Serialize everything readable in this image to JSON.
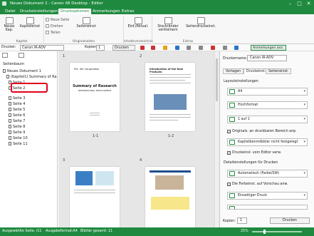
{
  "window": {
    "title": "Neues Dokument 1 - Canon iW Desktop - Editor",
    "minimize": "–",
    "maximize": "□",
    "close": "✕"
  },
  "menu": [
    "Datei",
    "Druckeinstellungen",
    "Druckoptionen",
    "Anmerkungen",
    "Extras"
  ],
  "ribbon": {
    "neues_kapitel": "Neues Kap.",
    "kapiteleinst": "Kapiteleinst",
    "neue_seite": "Neue Seite",
    "drehen": "Drehen",
    "teilen": "Teilen",
    "seiteneinst": "Seiteneinst",
    "einf_aktual": "Einf./Aktual.",
    "stockraender": "Stockränder verkleinern",
    "seitendruck": "Seitendruckeinst.",
    "groups": [
      "Kapitel",
      "Originalseiten",
      "Inhaltsverzeichnis",
      "Extras"
    ]
  },
  "toolbar": {
    "drucker_label": "Drucker:",
    "printer": "Canon iR-ADV",
    "kopien_label": "Kopien:",
    "copies": "1",
    "drucken": "Drucken",
    "anmerkungen": "Anmerkungen anz."
  },
  "tree": {
    "header": "Seitenbaum",
    "doc": "Neues Dokument 1",
    "chapter": "(Kapitel1) Summary of Ra",
    "pages": [
      "Seite 1",
      "Seite 2",
      "Seite 3",
      "Seite 4",
      "Seite 5",
      "Seite 6",
      "Seite 7",
      "Seite 8",
      "Seite 9",
      "Seite 10",
      "Seite 11"
    ]
  },
  "preview": {
    "groups": [
      "1",
      "2",
      "3",
      "4"
    ],
    "pages": [
      "1-1",
      "1-2"
    ],
    "doc_title": "Summary of Research",
    "doc_sub": "INTERNATIONAL INTELLIGENCE",
    "doc_head": "Pre. 4th Corporation",
    "p2_head": "Introduction of the New Products"
  },
  "panel": {
    "druckername_label": "Druckername:",
    "druckername": "Canon iR-ADV",
    "tabs": [
      "Vorlagen",
      "Druckeinst.",
      "Seiteneinst."
    ],
    "layout_label": "Layouteinstellungen",
    "size": "A4",
    "orient": "Hochformat",
    "nup": "1 auf 1",
    "chk1": "Originals. an druckbaren Bereich anp.",
    "binding": "Kapitelbenmöbkler nicht festgelegt",
    "chk2": "Druckeinst. vom Editor verw.",
    "detail_label": "Detaileinstellungen für Drucken",
    "color": "Automatisch (Farbe/SW)",
    "chk3": "Die Ferbeinst. auf Vorschau anw.",
    "duplex": "Einseitiger Druck",
    "kopien_label": "Kopien:",
    "copies": "1",
    "drucken": "Drucken"
  },
  "status": {
    "a": "Ausgewählte Seite: /11",
    "b": "Ausgabeformat:A4",
    "c": "Blätter gesamt: 11",
    "zoom": "25%"
  },
  "colors": {
    "accent": "#1f8a3f",
    "highlight": "#e2001a"
  }
}
